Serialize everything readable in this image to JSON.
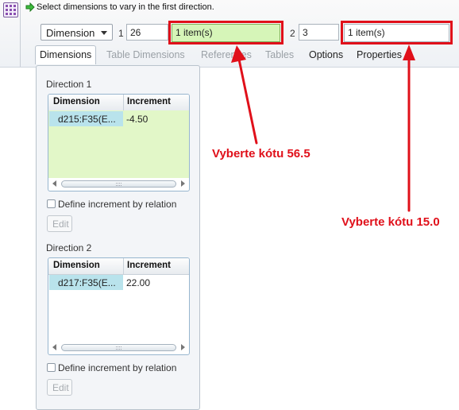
{
  "prompt": {
    "text": "Select dimensions to vary in the first direction."
  },
  "toolbar": {
    "type_dropdown": {
      "value": "Dimension"
    },
    "dir1": {
      "index_label": "1",
      "count_value": "26",
      "collector_value": "1 item(s)"
    },
    "dir2": {
      "index_label": "2",
      "count_value": "3",
      "collector_value": "1 item(s)"
    }
  },
  "tabs": [
    {
      "label": "Dimensions",
      "active": true,
      "enabled": true
    },
    {
      "label": "Table Dimensions",
      "active": false,
      "enabled": false
    },
    {
      "label": "References",
      "active": false,
      "enabled": false
    },
    {
      "label": "Tables",
      "active": false,
      "enabled": false
    },
    {
      "label": "Options",
      "active": false,
      "enabled": true
    },
    {
      "label": "Properties",
      "active": false,
      "enabled": true
    }
  ],
  "direction1": {
    "label": "Direction 1",
    "columns": [
      "Dimension",
      "Increment"
    ],
    "rows": [
      {
        "dimension": "d215:F35(E...",
        "increment": "-4.50"
      }
    ],
    "checkbox_label": "Define increment by relation",
    "edit_label": "Edit"
  },
  "direction2": {
    "label": "Direction 2",
    "columns": [
      "Dimension",
      "Increment"
    ],
    "rows": [
      {
        "dimension": "d217:F35(E...",
        "increment": "22.00"
      }
    ],
    "checkbox_label": "Define increment by relation",
    "edit_label": "Edit"
  },
  "annotations": {
    "left_text": "Vyberte kótu 56.5",
    "right_text": "Vyberte kótu 15.0"
  },
  "colors": {
    "accent_red": "#e0101a",
    "active_collector_bg": "#d6f5b8",
    "selected_cell_bg": "#b9e3ec",
    "table_fill_green": "#e2f7c8"
  }
}
